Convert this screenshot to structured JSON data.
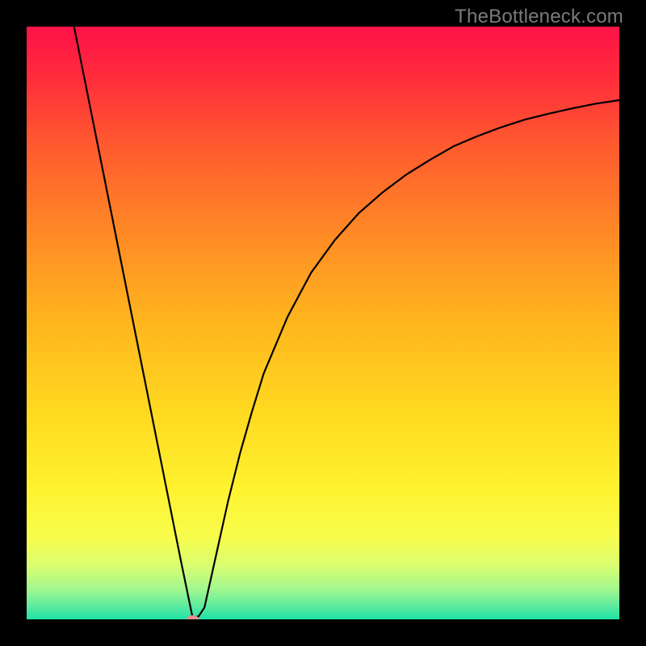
{
  "watermark": "TheBottleneck.com",
  "chart_data": {
    "type": "line",
    "title": "",
    "xlabel": "",
    "ylabel": "",
    "xlim": [
      0,
      100
    ],
    "ylim": [
      0,
      100
    ],
    "grid": false,
    "legend": false,
    "series": [
      {
        "name": "bottleneck-curve",
        "color": "#000000",
        "points": [
          {
            "x": 8.0,
            "y": 100.0
          },
          {
            "x": 10.0,
            "y": 90.0
          },
          {
            "x": 12.0,
            "y": 80.0
          },
          {
            "x": 14.0,
            "y": 70.0
          },
          {
            "x": 16.0,
            "y": 60.0
          },
          {
            "x": 18.0,
            "y": 50.0
          },
          {
            "x": 20.0,
            "y": 40.0
          },
          {
            "x": 22.0,
            "y": 30.0
          },
          {
            "x": 24.0,
            "y": 20.0
          },
          {
            "x": 26.0,
            "y": 10.0
          },
          {
            "x": 28.0,
            "y": 0.3
          },
          {
            "x": 29.0,
            "y": 0.5
          },
          {
            "x": 30.0,
            "y": 2.0
          },
          {
            "x": 32.0,
            "y": 11.0
          },
          {
            "x": 34.0,
            "y": 20.0
          },
          {
            "x": 36.0,
            "y": 28.0
          },
          {
            "x": 38.0,
            "y": 35.0
          },
          {
            "x": 40.0,
            "y": 41.5
          },
          {
            "x": 44.0,
            "y": 51.0
          },
          {
            "x": 48.0,
            "y": 58.5
          },
          {
            "x": 52.0,
            "y": 64.0
          },
          {
            "x": 56.0,
            "y": 68.5
          },
          {
            "x": 60.0,
            "y": 72.0
          },
          {
            "x": 64.0,
            "y": 75.0
          },
          {
            "x": 68.0,
            "y": 77.5
          },
          {
            "x": 72.0,
            "y": 79.8
          },
          {
            "x": 76.0,
            "y": 81.5
          },
          {
            "x": 80.0,
            "y": 83.0
          },
          {
            "x": 84.0,
            "y": 84.3
          },
          {
            "x": 88.0,
            "y": 85.3
          },
          {
            "x": 92.0,
            "y": 86.2
          },
          {
            "x": 96.0,
            "y": 87.0
          },
          {
            "x": 100.0,
            "y": 87.6
          }
        ]
      }
    ],
    "marker": {
      "name": "bottleneck-point",
      "x": 28.0,
      "y": 0.0,
      "color": "#e59090"
    },
    "background_gradient": {
      "stops": [
        {
          "offset": 0.0,
          "color": "#ff1249"
        },
        {
          "offset": 0.08,
          "color": "#ff2a3c"
        },
        {
          "offset": 0.2,
          "color": "#ff5a2f"
        },
        {
          "offset": 0.35,
          "color": "#ff8a25"
        },
        {
          "offset": 0.5,
          "color": "#ffb61e"
        },
        {
          "offset": 0.65,
          "color": "#ffd920"
        },
        {
          "offset": 0.78,
          "color": "#fff22f"
        },
        {
          "offset": 0.86,
          "color": "#f8fd4c"
        },
        {
          "offset": 0.91,
          "color": "#d9fd70"
        },
        {
          "offset": 0.95,
          "color": "#a0f78f"
        },
        {
          "offset": 0.98,
          "color": "#57eaa0"
        },
        {
          "offset": 1.0,
          "color": "#1de2a6"
        }
      ]
    }
  }
}
